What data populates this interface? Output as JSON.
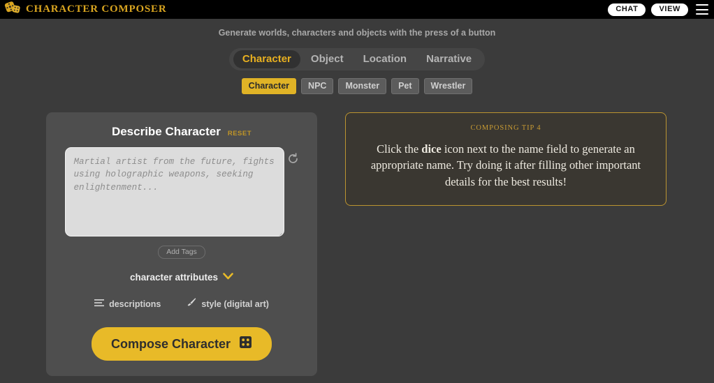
{
  "header": {
    "brand_title": "CHARACTER COMPOSER",
    "logo_icon": "dice-icon",
    "chat_label": "CHAT",
    "view_label": "VIEW",
    "menu_icon": "hamburger-menu-icon"
  },
  "tagline": "Generate worlds, characters and objects with the press of a button",
  "tabs": [
    {
      "label": "Character",
      "active": true
    },
    {
      "label": "Object",
      "active": false
    },
    {
      "label": "Location",
      "active": false
    },
    {
      "label": "Narrative",
      "active": false
    }
  ],
  "subtabs": [
    {
      "label": "Character",
      "active": true
    },
    {
      "label": "NPC",
      "active": false
    },
    {
      "label": "Monster",
      "active": false
    },
    {
      "label": "Pet",
      "active": false
    },
    {
      "label": "Wrestler",
      "active": false
    }
  ],
  "compose_panel": {
    "title": "Describe Character",
    "reset_label": "RESET",
    "textarea_value": "",
    "textarea_placeholder": "Martial artist from the future, fights using holographic weapons, seeking enlightenment...",
    "refresh_icon": "refresh-icon",
    "add_tags_label": "Add Tags",
    "attributes_label": "character attributes",
    "attributes_chevron_icon": "chevron-down-icon",
    "options": [
      {
        "label": "descriptions",
        "icon": "list-lines-icon"
      },
      {
        "label": "style (digital art)",
        "icon": "paintbrush-icon"
      }
    ],
    "compose_button_label": "Compose Character",
    "compose_button_icon": "dice-icon"
  },
  "tip": {
    "kicker": "COMPOSING TIP 4",
    "text_before": "Click the ",
    "text_bold": "dice",
    "text_after": " icon next to the name field to generate an appropriate name. Try doing it after filling other important details for the best results!"
  },
  "colors": {
    "accent_gold": "#e8ba28",
    "brand_gold": "#d9a520",
    "page_bg": "#3b3b3b",
    "panel_bg": "#4e4e4e",
    "topbar_bg": "#000000",
    "tip_border": "#bb9430"
  }
}
